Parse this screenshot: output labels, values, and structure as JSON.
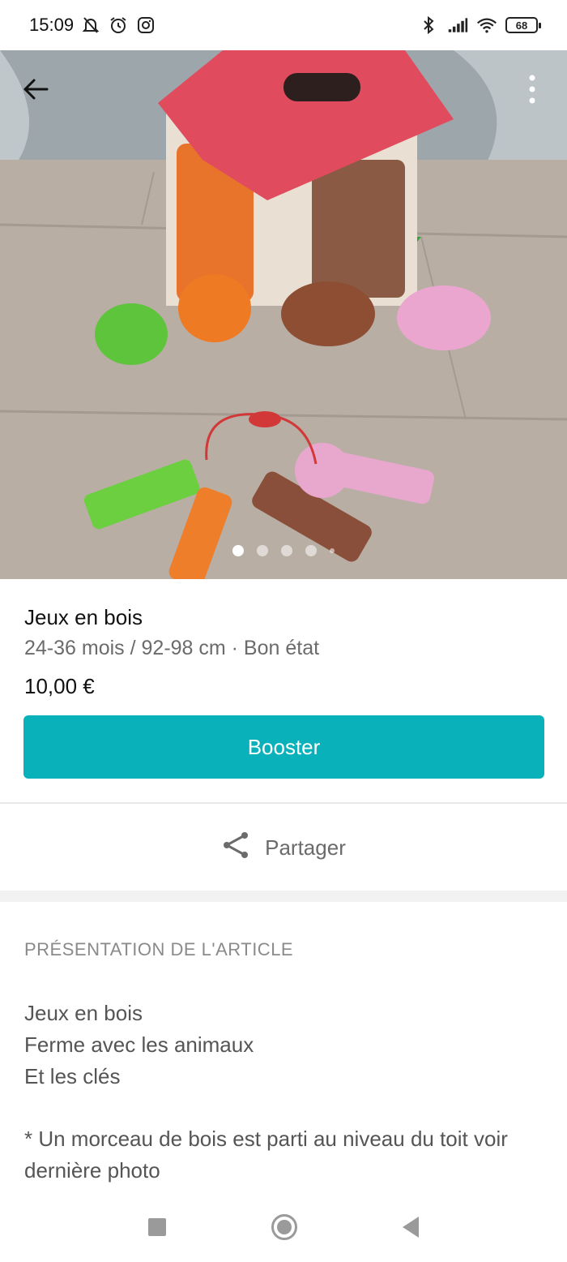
{
  "status_bar": {
    "time": "15:09",
    "battery": "68",
    "icons_left": [
      "bell-off-icon",
      "alarm-icon",
      "instagram-icon"
    ],
    "icons_right": [
      "bluetooth-icon",
      "signal-icon",
      "wifi-icon",
      "battery-icon"
    ]
  },
  "gallery": {
    "photo_count_dots": 5,
    "active_index": 0,
    "icons": [
      "back-arrow-icon",
      "more-vertical-icon"
    ]
  },
  "item": {
    "title": "Jeux en bois",
    "subtitle": "24-36 mois / 92-98 cm · Bon état",
    "price": "10,00 €"
  },
  "actions": {
    "booster_label": "Booster",
    "share_label": "Partager"
  },
  "description": {
    "section_title": "PRÉSENTATION DE L'ARTICLE",
    "lines": [
      "Jeux en bois",
      "Ferme avec les animaux",
      "Et les clés"
    ],
    "note": "* Un morceau de bois est parti au niveau du toit voir dernière photo"
  },
  "colors": {
    "accent": "#09b1ba",
    "muted_text": "#6b6b6b"
  }
}
